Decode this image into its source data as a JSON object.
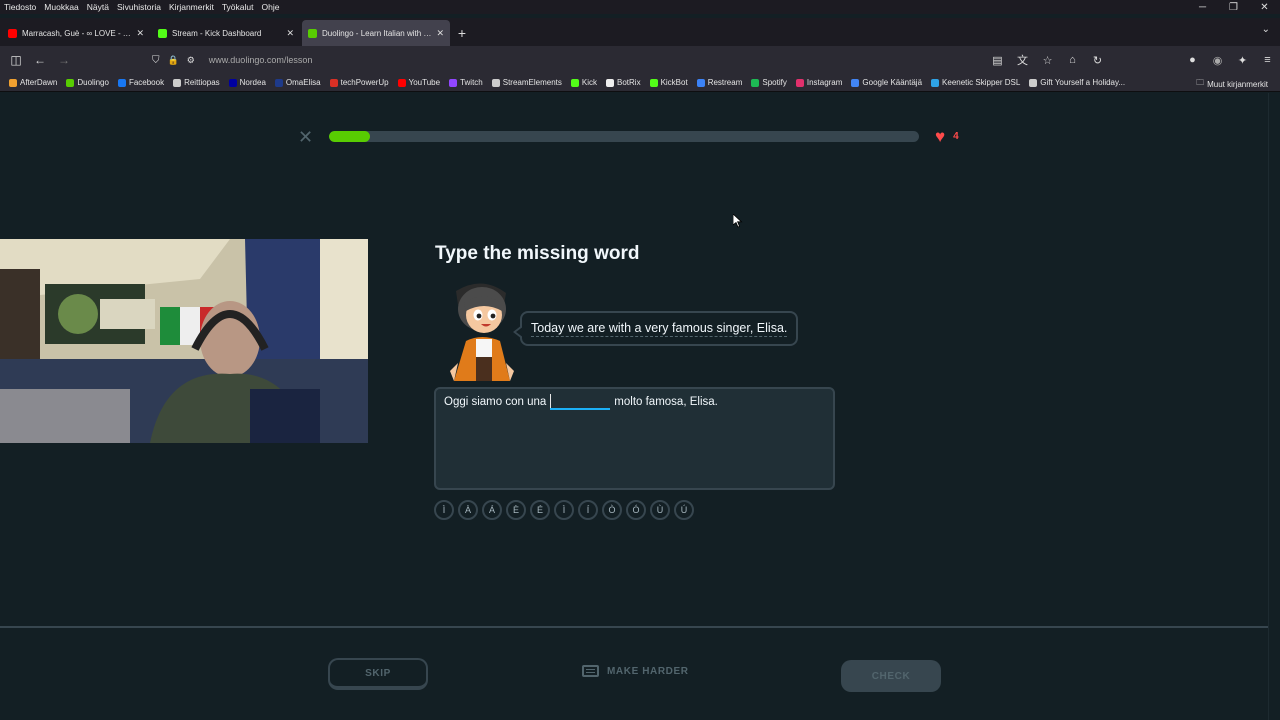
{
  "browser": {
    "menu": [
      "Tiedosto",
      "Muokkaa",
      "Näytä",
      "Sivuhistoria",
      "Kirjanmerkit",
      "Työkalut",
      "Ohje"
    ],
    "tabs": [
      {
        "title": "Marracash, Guè - ∞ LOVE - YouTube",
        "favicon_color": "#ff0000",
        "active": false
      },
      {
        "title": "Stream - Kick Dashboard",
        "favicon_color": "#53fc18",
        "active": false
      },
      {
        "title": "Duolingo - Learn Italian with lessons",
        "favicon_color": "#58cc02",
        "active": true
      }
    ],
    "url": "www.duolingo.com/lesson",
    "bookmarks": [
      {
        "label": "AfterDawn",
        "color": "#f0a030"
      },
      {
        "label": "Duolingo",
        "color": "#58cc02"
      },
      {
        "label": "Facebook",
        "color": "#1877f2"
      },
      {
        "label": "Reittiopas",
        "color": "#cccccc"
      },
      {
        "label": "Nordea",
        "color": "#0000a0"
      },
      {
        "label": "OmaElisa",
        "color": "#1e3a8a"
      },
      {
        "label": "techPowerUp",
        "color": "#d93025"
      },
      {
        "label": "YouTube",
        "color": "#ff0000"
      },
      {
        "label": "Twitch",
        "color": "#9146ff"
      },
      {
        "label": "StreamElements",
        "color": "#cccccc"
      },
      {
        "label": "Kick",
        "color": "#53fc18"
      },
      {
        "label": "BotRix",
        "color": "#eeeeee"
      },
      {
        "label": "KickBot",
        "color": "#53fc18"
      },
      {
        "label": "Restream",
        "color": "#3b82f6"
      },
      {
        "label": "Spotify",
        "color": "#1db954"
      },
      {
        "label": "Instagram",
        "color": "#e1306c"
      },
      {
        "label": "Google Kääntäjä",
        "color": "#4285f4"
      },
      {
        "label": "Keenetic Skipper DSL",
        "color": "#2fa3e6"
      },
      {
        "label": "Gift Yourself a Holiday...",
        "color": "#cccccc"
      }
    ],
    "other_bookmarks": "Muut kirjanmerkit"
  },
  "lesson": {
    "progress_percent": 7,
    "hearts": "4",
    "prompt": "Type the missing word",
    "bubble_text": "Today we are with a very famous singer, Elisa.",
    "sentence_before": "Oggi siamo con una",
    "sentence_after": "molto famosa, Elisa.",
    "answer_value": "",
    "special_keys": [
      "Ì",
      "À",
      "Á",
      "È",
      "É",
      "Ì",
      "Í",
      "Ò",
      "Ó",
      "Ù",
      "Ú"
    ],
    "skip_label": "SKIP",
    "make_harder_label": "MAKE HARDER",
    "check_label": "CHECK"
  },
  "colors": {
    "background": "#131f24",
    "progress_green": "#58cc02",
    "heart_red": "#ff4b4b",
    "input_accent": "#1cb0f6"
  }
}
